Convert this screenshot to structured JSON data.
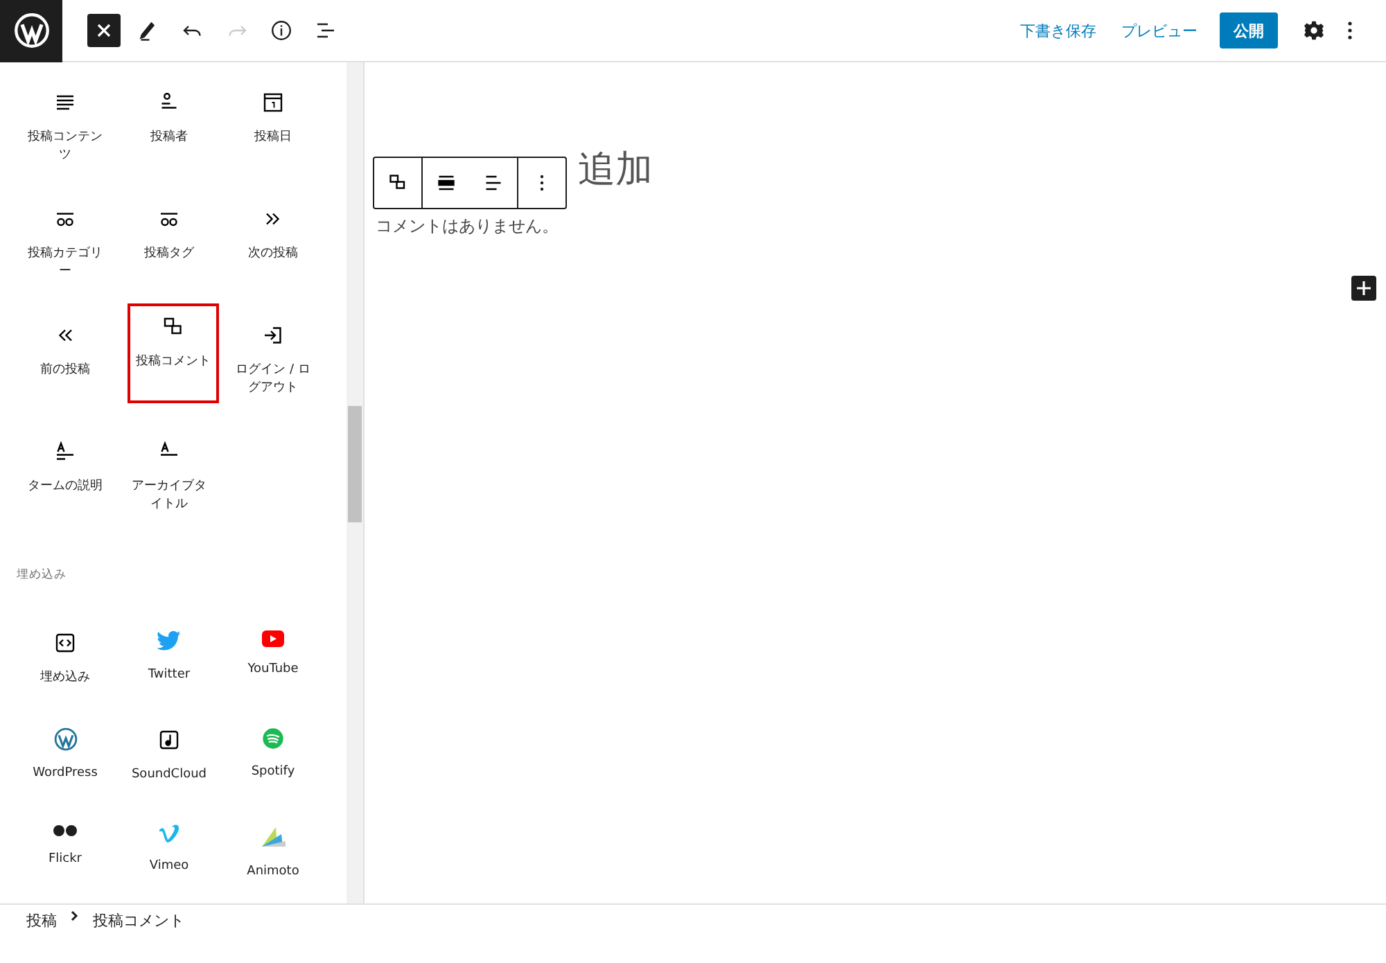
{
  "toolbar": {
    "actions": [
      {
        "label": "下書き保存"
      },
      {
        "label": "プレビュー"
      }
    ],
    "publish": "公開"
  },
  "inserter": {
    "blocks": [
      {
        "label": "投稿コンテンツ",
        "selected": false
      },
      {
        "label": "投稿者",
        "selected": false
      },
      {
        "label": "投稿日",
        "selected": false
      },
      {
        "label": "投稿カテゴリー",
        "selected": false
      },
      {
        "label": "投稿タグ",
        "selected": false
      },
      {
        "label": "次の投稿",
        "selected": false
      },
      {
        "label": "前の投稿",
        "selected": false
      },
      {
        "label": "投稿コメント",
        "selected": true
      },
      {
        "label": "ログイン / ログアウト",
        "selected": false
      },
      {
        "label": "タームの説明",
        "selected": false
      },
      {
        "label": "アーカイブタイトル",
        "selected": false
      }
    ],
    "embed_heading": "埋め込み",
    "embeds": [
      {
        "label": "埋め込み"
      },
      {
        "label": "Twitter"
      },
      {
        "label": "YouTube"
      },
      {
        "label": "WordPress"
      },
      {
        "label": "SoundCloud"
      },
      {
        "label": "Spotify"
      },
      {
        "label": "Flickr"
      },
      {
        "label": "Vimeo"
      },
      {
        "label": "Animoto"
      }
    ]
  },
  "editor": {
    "title": "追加",
    "comments_text": "コメントはありません。"
  },
  "breadcrumb": [
    {
      "label": "投稿"
    },
    {
      "label": "投稿コメント"
    }
  ]
}
